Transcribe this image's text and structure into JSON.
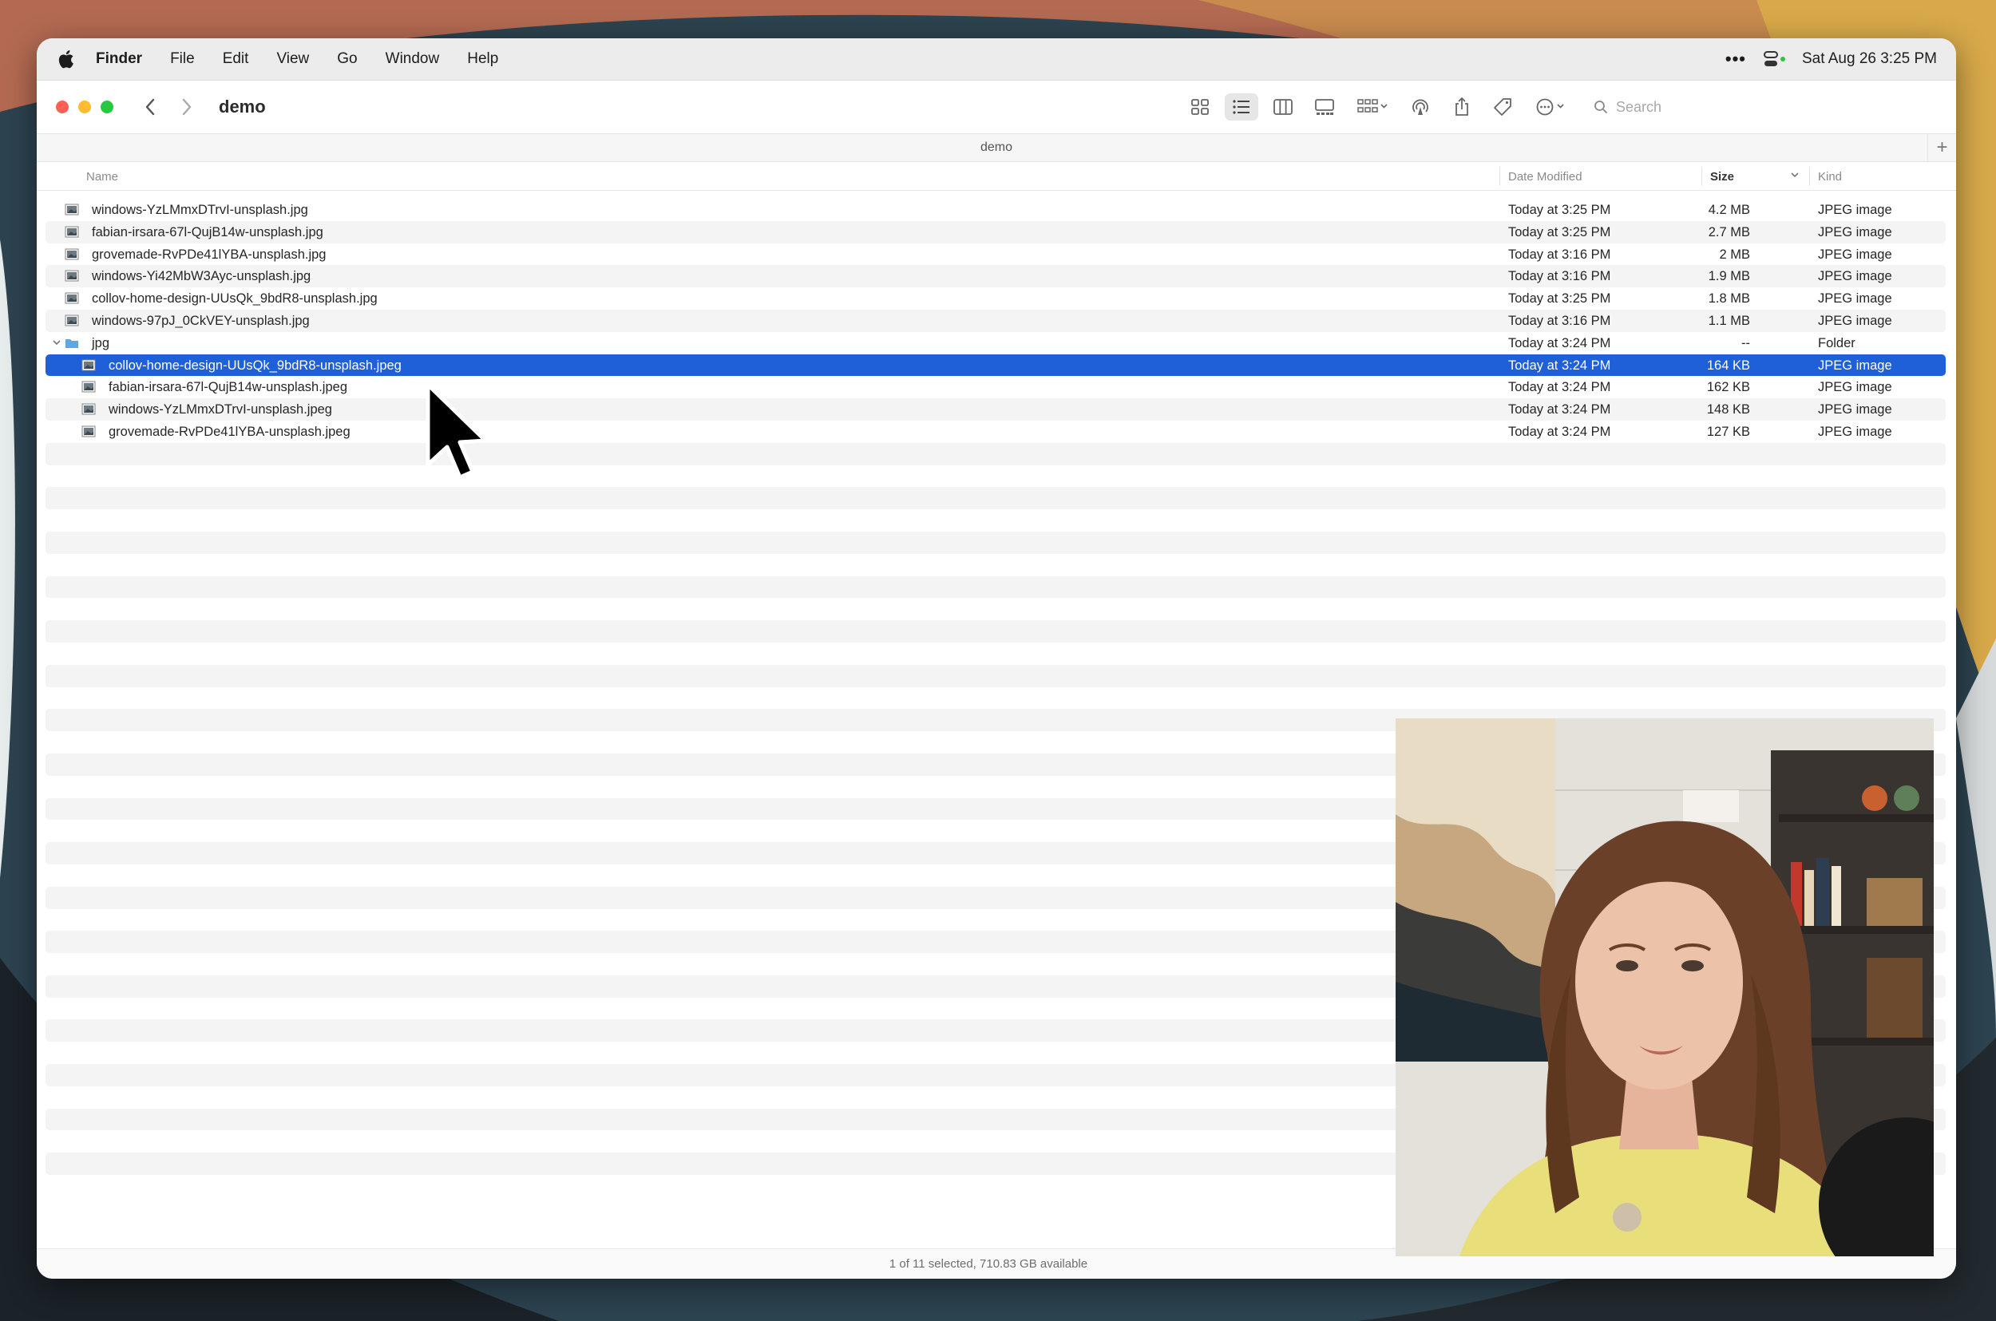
{
  "menubar": {
    "app": "Finder",
    "items": [
      "File",
      "Edit",
      "View",
      "Go",
      "Window",
      "Help"
    ],
    "overflow": "•••",
    "clock": "Sat Aug 26  3:25 PM"
  },
  "toolbar": {
    "title": "demo",
    "search_placeholder": "Search"
  },
  "pathbar": {
    "label": "demo",
    "add_tab": "+"
  },
  "columns": {
    "name": "Name",
    "date": "Date Modified",
    "size": "Size",
    "kind": "Kind"
  },
  "files": [
    {
      "name": "windows-YzLMmxDTrvI-unsplash.jpg",
      "date": "Today at 3:25 PM",
      "size": "4.2 MB",
      "kind": "JPEG image",
      "indent": 0,
      "type": "file"
    },
    {
      "name": "fabian-irsara-67l-QujB14w-unsplash.jpg",
      "date": "Today at 3:25 PM",
      "size": "2.7 MB",
      "kind": "JPEG image",
      "indent": 0,
      "type": "file"
    },
    {
      "name": "grovemade-RvPDe41lYBA-unsplash.jpg",
      "date": "Today at 3:16 PM",
      "size": "2 MB",
      "kind": "JPEG image",
      "indent": 0,
      "type": "file"
    },
    {
      "name": "windows-Yi42MbW3Ayc-unsplash.jpg",
      "date": "Today at 3:16 PM",
      "size": "1.9 MB",
      "kind": "JPEG image",
      "indent": 0,
      "type": "file"
    },
    {
      "name": "collov-home-design-UUsQk_9bdR8-unsplash.jpg",
      "date": "Today at 3:25 PM",
      "size": "1.8 MB",
      "kind": "JPEG image",
      "indent": 0,
      "type": "file"
    },
    {
      "name": "windows-97pJ_0CkVEY-unsplash.jpg",
      "date": "Today at 3:16 PM",
      "size": "1.1 MB",
      "kind": "JPEG image",
      "indent": 0,
      "type": "file"
    },
    {
      "name": "jpg",
      "date": "Today at 3:24 PM",
      "size": "--",
      "kind": "Folder",
      "indent": 0,
      "type": "folder"
    },
    {
      "name": "collov-home-design-UUsQk_9bdR8-unsplash.jpeg",
      "date": "Today at 3:24 PM",
      "size": "164 KB",
      "kind": "JPEG image",
      "indent": 1,
      "type": "file",
      "selected": true
    },
    {
      "name": "fabian-irsara-67l-QujB14w-unsplash.jpeg",
      "date": "Today at 3:24 PM",
      "size": "162 KB",
      "kind": "JPEG image",
      "indent": 1,
      "type": "file"
    },
    {
      "name": "windows-YzLMmxDTrvI-unsplash.jpeg",
      "date": "Today at 3:24 PM",
      "size": "148 KB",
      "kind": "JPEG image",
      "indent": 1,
      "type": "file"
    },
    {
      "name": "grovemade-RvPDe41lYBA-unsplash.jpeg",
      "date": "Today at 3:24 PM",
      "size": "127 KB",
      "kind": "JPEG image",
      "indent": 1,
      "type": "file"
    }
  ],
  "status": "1 of 11 selected, 710.83 GB available",
  "colors": {
    "selection": "#1f5fd8",
    "close": "#fe5f57",
    "minimize": "#febc2e",
    "zoom": "#28c840",
    "folder": "#5aa9e6"
  }
}
